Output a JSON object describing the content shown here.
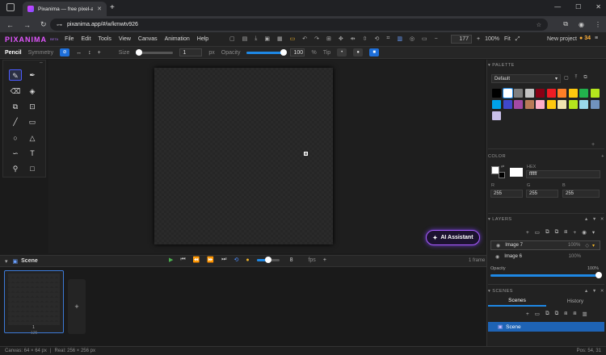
{
  "browser": {
    "tab_title": "Pixanima — free pixel-art & ani",
    "url": "pixanima.app/#/w/kmwtv926"
  },
  "app": {
    "logo": "PIXANIMA",
    "logo_badge": "BETA",
    "menu": [
      "File",
      "Edit",
      "Tools",
      "View",
      "Canvas",
      "Animation",
      "Help"
    ],
    "zoom_value": "177",
    "zoom_percent": "100%",
    "fit_label": "Fit",
    "new_project_label": "New project",
    "coins": "34"
  },
  "options": {
    "tool_name": "Pencil",
    "symmetry_label": "Symmetry",
    "size_label": "Size",
    "size_value": "1",
    "size_unit": "px",
    "size_level": 0.05,
    "opacity_label": "Opacity",
    "opacity_value": "100",
    "opacity_unit": "%",
    "opacity_level": 1.0,
    "tip_label": "Tip"
  },
  "canvas": {
    "ai_assistant_label": "AI Assistant"
  },
  "timeline": {
    "scene_label": "Scene",
    "fps_value": "8",
    "fps_label": "fps",
    "frame_count": "1 frame",
    "frame1_number": "1",
    "frame1_duration": "125"
  },
  "status": {
    "canvas_size": "Canvas: 64 × 64 px",
    "real_size": "Real: 256 × 256 px",
    "position": "Pos: 54, 31"
  },
  "palette": {
    "header": "PALETTE",
    "selected": "Default",
    "colors": [
      "#000000",
      "#ffffff",
      "#7f7f7f",
      "#c3c3c3",
      "#880015",
      "#ed1c24",
      "#ff7f27",
      "#ffc90e",
      "#22b14c",
      "#b5e61d",
      "#00a2e8",
      "#3f48cc",
      "#a349a4",
      "#b97a57",
      "#ffaec9",
      "#ffc90e",
      "#efe4b0",
      "#b5e61d",
      "#99d9ea",
      "#7092be",
      "#c8bfe7"
    ]
  },
  "color": {
    "header": "COLOR",
    "hex_label": "HEX",
    "hex_value": "ffffff",
    "r_label": "R",
    "g_label": "G",
    "b_label": "B",
    "r_value": "255",
    "g_value": "255",
    "b_value": "255"
  },
  "layers": {
    "header": "LAYERS",
    "items": [
      {
        "name": "Image 7",
        "opacity": "100%"
      },
      {
        "name": "Image 6",
        "opacity": "100%"
      }
    ],
    "opacity_label": "Opacity",
    "opacity_value": "100%",
    "opacity_level": 1.0
  },
  "scenes": {
    "header": "SCENES",
    "tab_scenes": "Scenes",
    "tab_history": "History",
    "items": [
      "Scene"
    ]
  },
  "colors": {
    "accent": "#1e88e5",
    "brand": "#e256ff",
    "ai_border": "#a95cff"
  }
}
